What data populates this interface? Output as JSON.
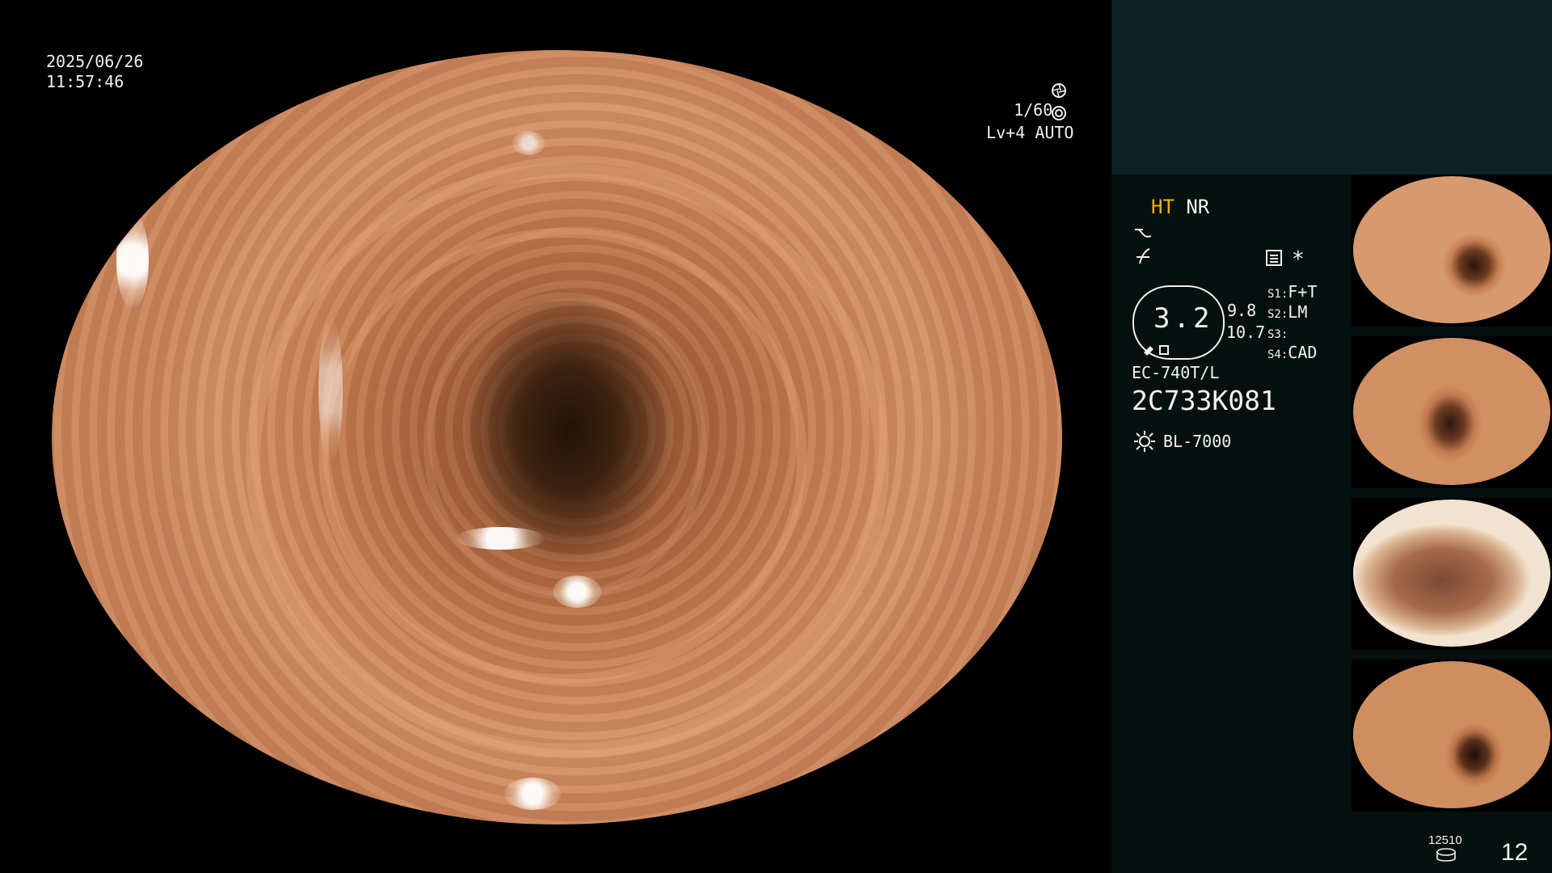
{
  "overlay": {
    "date": "2025/06/26",
    "time": "11:57:46",
    "shutter": "1/60",
    "level": "Lv+4",
    "exposure_mode": "AUTO"
  },
  "settings": {
    "ht": "HT",
    "nr": "NR",
    "enhance_value": "3.2",
    "value_a": "9.8",
    "value_b": "10.7",
    "switches": [
      {
        "key": "S1:",
        "value": "F+T"
      },
      {
        "key": "S2:",
        "value": "LM"
      },
      {
        "key": "S3:",
        "value": ""
      },
      {
        "key": "S4:",
        "value": "CAD"
      }
    ],
    "scope_model": "EC-740T/L",
    "serial": "2C733K081",
    "light_source": "BL-7000",
    "asterisk": "*"
  },
  "footer": {
    "storage_count": "12510",
    "image_count": "12"
  },
  "colors": {
    "accent_ht": "#f6b400",
    "panel_dark": "#06110f",
    "panel_top": "#0b2322"
  },
  "icons": [
    "shutter-icon",
    "iris-icon",
    "curve-icon",
    "edge-icon",
    "menu-icon",
    "light-icon",
    "disk-icon"
  ]
}
